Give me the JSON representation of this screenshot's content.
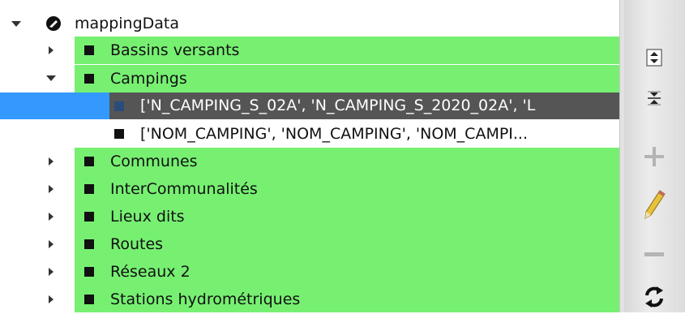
{
  "tree": {
    "root": {
      "label": "mappingData",
      "icon": "key-icon"
    },
    "items": [
      {
        "label": "Bassins versants"
      },
      {
        "label": "Campings"
      },
      {
        "label": "['N_CAMPING_S_02A', 'N_CAMPING_S_2020_02A', 'L"
      },
      {
        "label": "['NOM_CAMPING', 'NOM_CAMPING', 'NOM_CAMPI..."
      },
      {
        "label": "Communes"
      },
      {
        "label": "InterCommunalités"
      },
      {
        "label": "Lieux dits"
      },
      {
        "label": "Routes"
      },
      {
        "label": "Réseaux 2"
      },
      {
        "label": "Stations hydrométriques"
      }
    ]
  },
  "toolbar": {
    "buttons": [
      {
        "icon": "expand-all-icon"
      },
      {
        "icon": "collapse-all-icon"
      },
      {
        "icon": "add-icon"
      },
      {
        "icon": "edit-pencil-icon"
      },
      {
        "icon": "remove-icon"
      },
      {
        "icon": "refresh-icon"
      }
    ]
  },
  "colors": {
    "row_bg": "#77f072",
    "selection": "#555555",
    "selection_accent": "#3399ff"
  }
}
